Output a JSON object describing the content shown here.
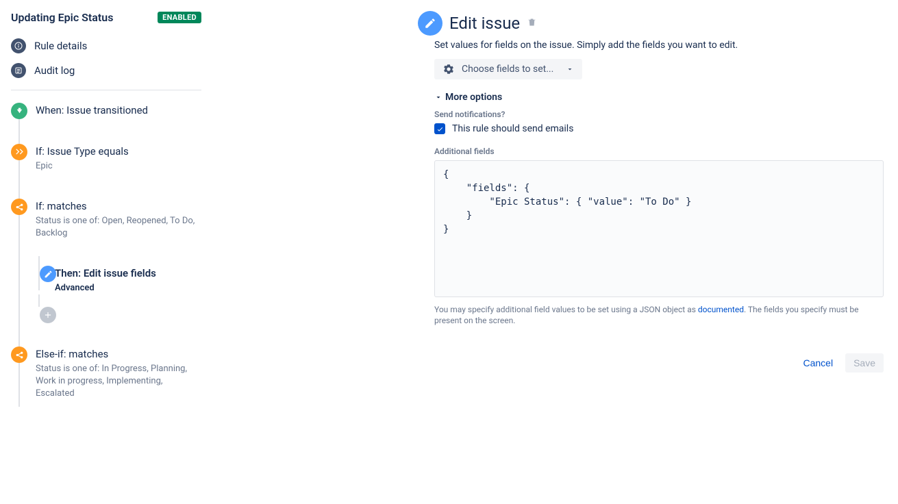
{
  "rule": {
    "title": "Updating Epic Status",
    "status_badge": "ENABLED"
  },
  "nav": {
    "details": "Rule details",
    "audit": "Audit log"
  },
  "flow": {
    "trigger": {
      "title": "When: Issue transitioned"
    },
    "cond1": {
      "title": "If: Issue Type equals",
      "desc": "Epic"
    },
    "cond2": {
      "title": "If: matches",
      "desc": "Status is one of: Open, Reopened, To Do, Backlog"
    },
    "action": {
      "title": "Then: Edit issue fields",
      "desc": "Advanced"
    },
    "cond3": {
      "title": "Else-if: matches",
      "desc": "Status is one of: In Progress, Planning, Work in progress, Implementing, Escalated"
    }
  },
  "panel": {
    "title": "Edit issue",
    "desc": "Set values for fields on the issue. Simply add the fields you want to edit.",
    "choose_fields": "Choose fields to set...",
    "more_options": "More options",
    "send_notifications_label": "Send notifications?",
    "send_emails_label": "This rule should send emails",
    "additional_fields_label": "Additional fields",
    "additional_fields_value": "{\n    \"fields\": {\n        \"Epic Status\": { \"value\": \"To Do\" }\n    }\n}",
    "help_text_1": "You may specify additional field values to be set using a JSON object as ",
    "help_link": "documented",
    "help_text_2": ". The fields you specify must be present on the screen.",
    "cancel": "Cancel",
    "save": "Save"
  }
}
